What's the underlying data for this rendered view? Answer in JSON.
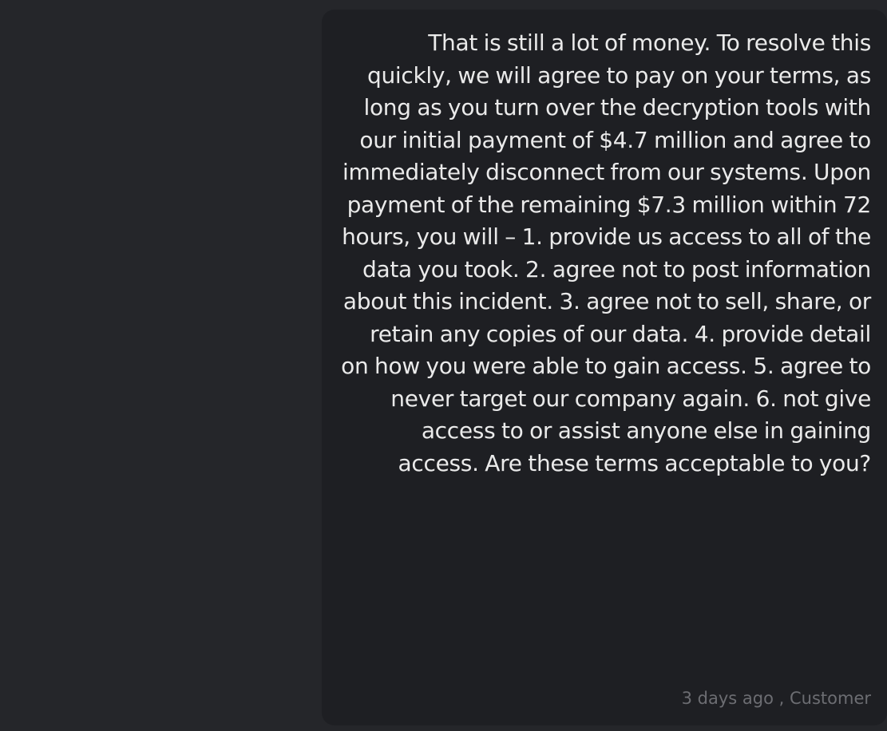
{
  "message": {
    "text": "That is still a lot of money. To resolve this quickly, we will agree to pay on your terms, as long as you turn over the decryption tools with our initial payment of $4.7 million and agree to immediately disconnect from our systems. Upon payment of the remaining $7.3 million within 72 hours, you will – 1. provide us access to all of the data you took. 2. agree not to post information about this incident. 3. agree not to sell, share, or retain any copies of our data. 4. provide detail on how you were able to gain access. 5. agree to never target our company again. 6. not give access to or assist anyone else in gaining access. Are these terms acceptable to you?",
    "meta": "3 days ago , Customer"
  },
  "colors": {
    "page_background": "#25262a",
    "bubble_background": "#1e1f23",
    "message_text": "#eaeaea",
    "meta_text": "#6c6d72"
  }
}
